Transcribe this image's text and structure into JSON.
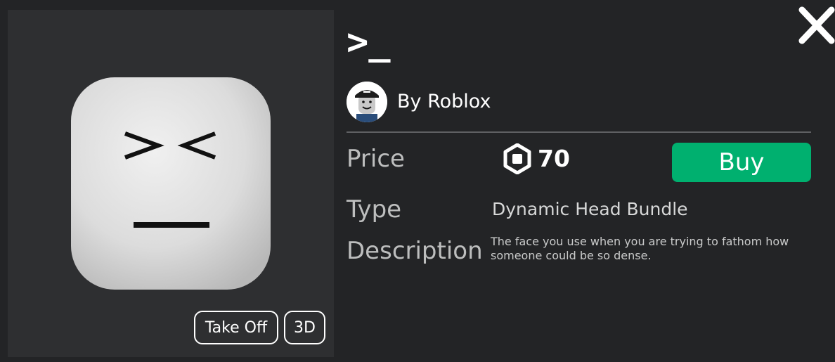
{
  "item": {
    "title": ">_",
    "creator": "By Roblox",
    "price_label": "Price",
    "price": "70",
    "buy_label": "Buy",
    "type_label": "Type",
    "type_value": "Dynamic Head Bundle",
    "description_label": "Description",
    "description": "The face you use when you are trying to fathom how someone could be so dense."
  },
  "preview": {
    "take_off_label": "Take Off",
    "view_3d_label": "3D",
    "face_expression": "squinting-head"
  },
  "icons": {
    "close": "close-icon",
    "currency": "robux-icon",
    "avatar": "creator-avatar"
  },
  "colors": {
    "background": "#232426",
    "panel": "#2e2f31",
    "buy_button": "#00b06f",
    "label_text": "#bdbebe",
    "divider": "#5f6063"
  }
}
